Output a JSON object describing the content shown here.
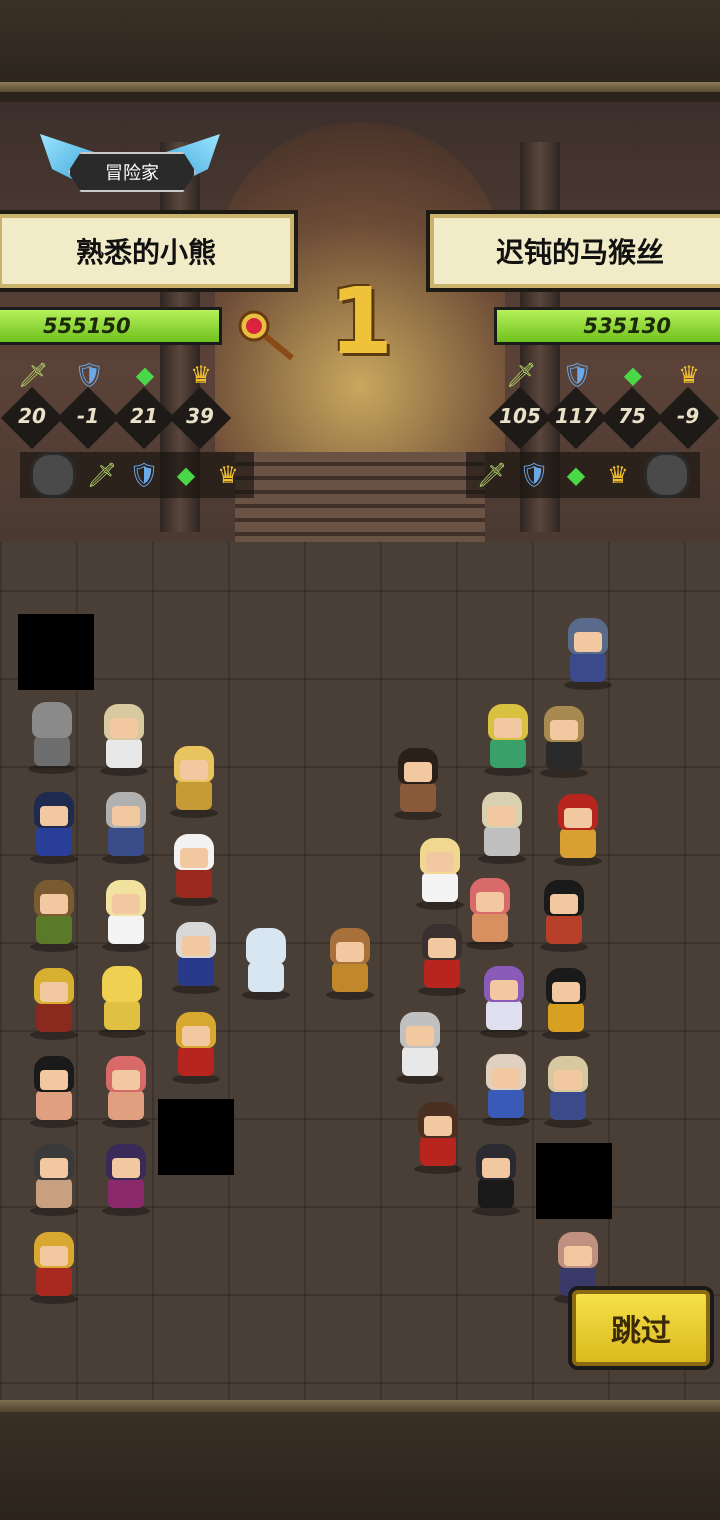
{
  "badge": {
    "label": "冒险家"
  },
  "left_player": {
    "name": "熟悉的小熊",
    "score": "555150",
    "stats": [
      {
        "icon": "sword-icon",
        "glyph": "🗡",
        "value": "20"
      },
      {
        "icon": "shield-icon",
        "glyph": "🛡",
        "value": "-1"
      },
      {
        "icon": "gem-icon",
        "glyph": "◆",
        "value": "21"
      },
      {
        "icon": "crown-icon",
        "glyph": "♛",
        "value": "39"
      }
    ]
  },
  "right_player": {
    "name": "迟钝的马猴丝",
    "score": "535130",
    "stats": [
      {
        "icon": "sword-icon",
        "glyph": "🗡",
        "value": "105"
      },
      {
        "icon": "shield-icon",
        "glyph": "🛡",
        "value": "117"
      },
      {
        "icon": "gem-icon",
        "glyph": "◆",
        "value": "75"
      },
      {
        "icon": "crown-icon",
        "glyph": "♛",
        "value": "-9"
      }
    ]
  },
  "round": {
    "number": "1"
  },
  "skip_button": {
    "label": "跳过"
  },
  "colors": {
    "accent": "#f0c23a",
    "hp": "#8fdc2e",
    "name_plate": "#f1ecc7"
  }
}
